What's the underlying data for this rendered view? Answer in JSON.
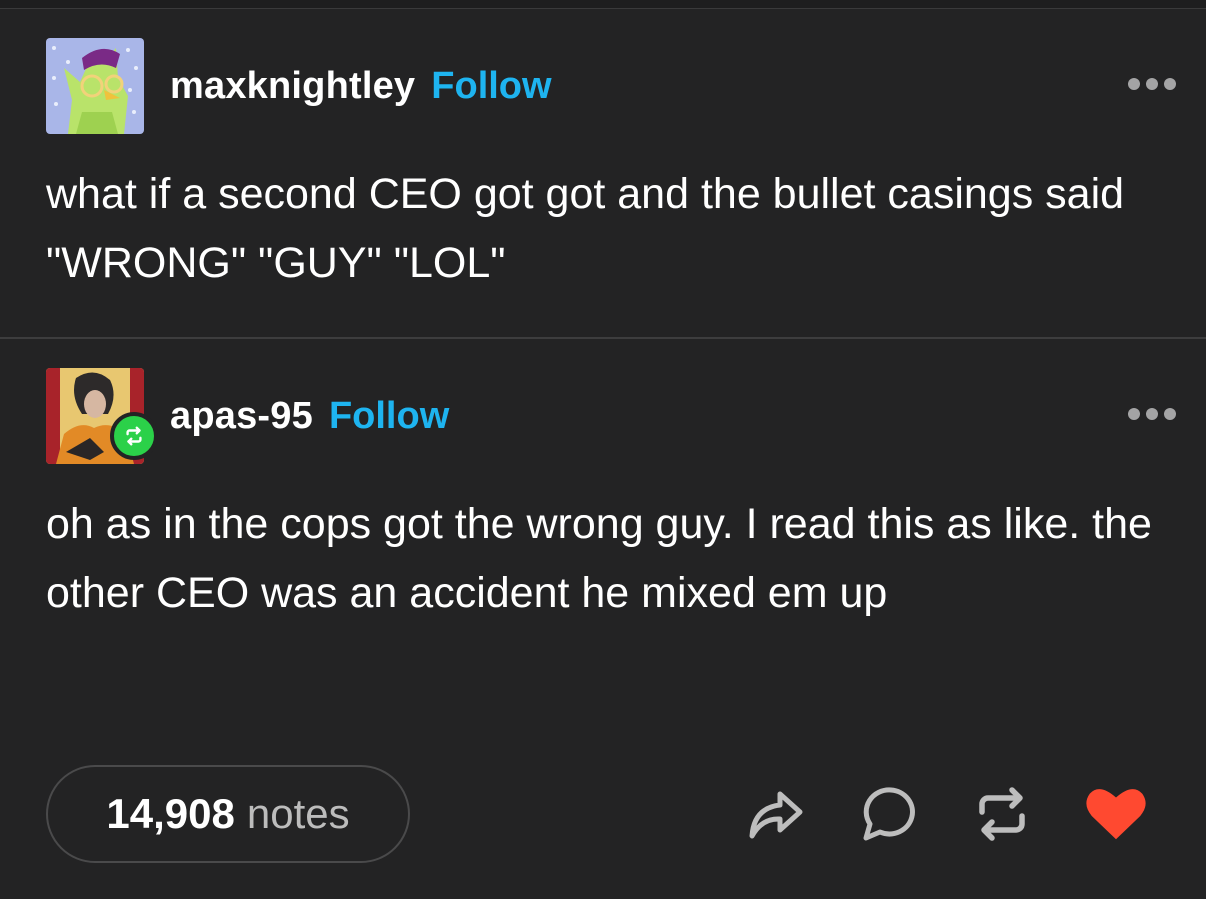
{
  "post": {
    "author": "maxknightley",
    "follow_label": "Follow",
    "text": "what if a second CEO got got and the bullet casings said \"WRONG\" \"GUY\" \"LOL\""
  },
  "reblog": {
    "author": "apas-95",
    "follow_label": "Follow",
    "text": "oh as in the cops got the wrong guy. I read this as like. the other CEO was an accident he mixed em up"
  },
  "footer": {
    "notes_count": "14,908",
    "notes_label": "notes",
    "actions": [
      "share-icon",
      "comment-icon",
      "reblog-icon",
      "heart-icon"
    ]
  },
  "colors": {
    "background": "#232324",
    "follow": "#1eb4f0",
    "reblog_badge": "#2bd149",
    "heart": "#ff4930"
  }
}
